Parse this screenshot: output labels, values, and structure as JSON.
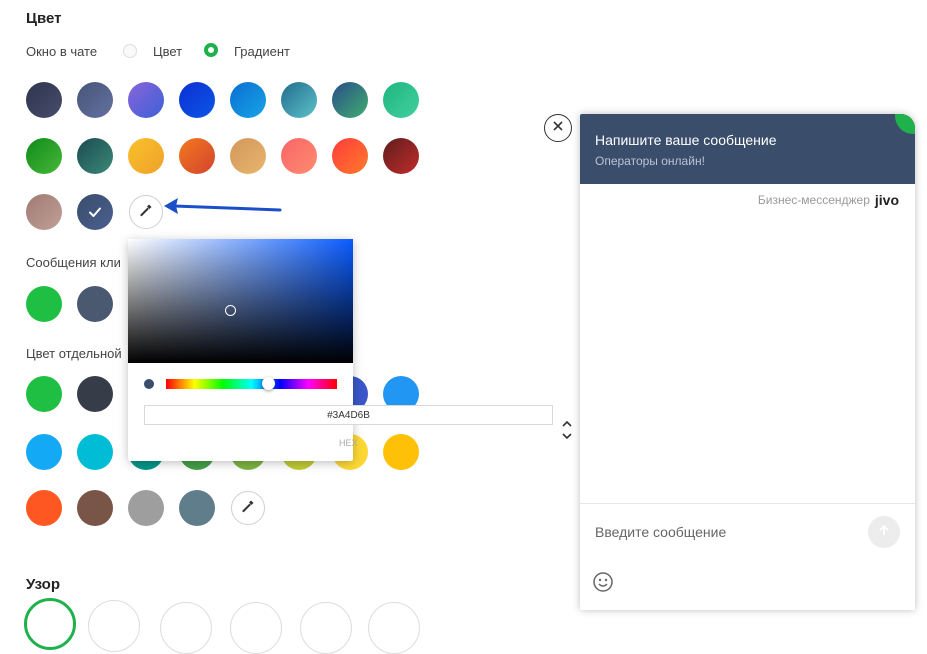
{
  "section": {
    "title": "Цвет",
    "pattern_title": "Узор"
  },
  "chat_window": {
    "label": "Окно в чате",
    "option_color": "Цвет",
    "option_gradient": "Градиент",
    "selected": "gradient",
    "swatches": [
      {
        "name": "swatch-dark-slate",
        "bg": "linear-gradient(135deg,#2f3550,#474d6a)"
      },
      {
        "name": "swatch-slate-blue",
        "bg": "linear-gradient(135deg,#475478,#6371a0)"
      },
      {
        "name": "swatch-purple-blue",
        "bg": "linear-gradient(135deg,#8a64d9,#3c61d8)"
      },
      {
        "name": "swatch-deep-blue",
        "bg": "linear-gradient(135deg,#0d2fd3,#0a56e6)"
      },
      {
        "name": "swatch-sky-blue",
        "bg": "linear-gradient(135deg,#0a6fd1,#18a3e8)"
      },
      {
        "name": "swatch-teal-blue",
        "bg": "linear-gradient(135deg,#236b8e,#5bc3c8)"
      },
      {
        "name": "swatch-blue-green",
        "bg": "linear-gradient(135deg,#2a4d8a,#3fae6e)"
      },
      {
        "name": "swatch-mint",
        "bg": "linear-gradient(135deg,#1fb57f,#41d0a0)"
      },
      {
        "name": "swatch-green",
        "bg": "linear-gradient(135deg,#0e8a1a,#48b838)"
      },
      {
        "name": "swatch-dark-teal",
        "bg": "linear-gradient(135deg,#1c4a53,#3b8a76)"
      },
      {
        "name": "swatch-yellow",
        "bg": "linear-gradient(135deg,#f9c22b,#f0a02a)"
      },
      {
        "name": "swatch-orange",
        "bg": "linear-gradient(135deg,#f3791e,#d2442e)"
      },
      {
        "name": "swatch-tan",
        "bg": "linear-gradient(135deg,#d2975a,#e8b56e)"
      },
      {
        "name": "swatch-salmon",
        "bg": "linear-gradient(135deg,#f96468,#ff8c70)"
      },
      {
        "name": "swatch-red-orange",
        "bg": "linear-gradient(135deg,#ff3c3c,#ff7a2a)"
      },
      {
        "name": "swatch-maroon",
        "bg": "linear-gradient(135deg,#5f1e1e,#c22a2a)"
      },
      {
        "name": "swatch-rose-brown",
        "bg": "linear-gradient(135deg,#a07a72,#c0a098)"
      },
      {
        "name": "swatch-selected-navy",
        "bg": "linear-gradient(135deg,#3A4D6B,#4a5f90)"
      }
    ]
  },
  "client_messages": {
    "label": "Сообщения кли",
    "swatches": [
      {
        "name": "swatch-client-green",
        "bg": "#1fbf44"
      },
      {
        "name": "swatch-client-slate",
        "bg": "#4a5870"
      }
    ]
  },
  "elements": {
    "label": "Цвет отдельной",
    "row1": [
      {
        "name": "swatch-el-green",
        "bg": "#1fbf44"
      },
      {
        "name": "swatch-el-charcoal",
        "bg": "#363c48"
      },
      {
        "name": "swatch-el-indigo",
        "bg": "#3a56c8"
      },
      {
        "name": "swatch-el-blue",
        "bg": "#2196f3"
      }
    ],
    "row2": [
      {
        "name": "swatch-el-light-blue",
        "bg": "#14a9f4"
      },
      {
        "name": "swatch-el-cyan",
        "bg": "#00bcd4"
      },
      {
        "name": "swatch-el-teal",
        "bg": "#009688"
      },
      {
        "name": "swatch-el-med-green",
        "bg": "#43a047"
      },
      {
        "name": "swatch-el-lime",
        "bg": "#7cb342"
      },
      {
        "name": "swatch-el-yellow-green",
        "bg": "#c0ca33"
      },
      {
        "name": "swatch-el-light-yellow",
        "bg": "#fdd835"
      },
      {
        "name": "swatch-el-amber",
        "bg": "#ffc107"
      }
    ],
    "row3": [
      {
        "name": "swatch-el-deep-orange",
        "bg": "#ff5722"
      },
      {
        "name": "swatch-el-brown",
        "bg": "#795548"
      },
      {
        "name": "swatch-el-grey",
        "bg": "#9e9e9e"
      },
      {
        "name": "swatch-el-blue-grey",
        "bg": "#607d8b"
      }
    ]
  },
  "picker": {
    "hex": "#3A4D6B",
    "mode": "HEX",
    "hue_fraction": 0.6
  },
  "widget": {
    "title": "Напишите ваше сообщение",
    "subtitle": "Операторы онлайн!",
    "brand_text": "Бизнес-мессенджер",
    "brand_logo": "jivo",
    "input_placeholder": "Введите сообщение",
    "header_color": "#3A4D6B",
    "accent_color": "#1fb14b"
  }
}
